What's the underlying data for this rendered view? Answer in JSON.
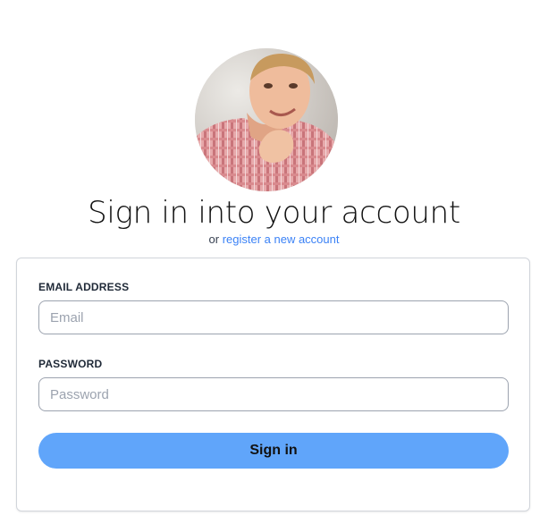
{
  "header": {
    "title": "Sign in into your account",
    "subtitle_prefix": "or",
    "register_link": "register a new account"
  },
  "form": {
    "email": {
      "label": "EMAIL ADDRESS",
      "placeholder": "Email",
      "value": ""
    },
    "password": {
      "label": "PASSWORD",
      "placeholder": "Password",
      "value": ""
    },
    "submit_label": "Sign in"
  },
  "colors": {
    "accent": "#60a5fa",
    "link": "#3b82f6",
    "border": "#d1d5db"
  }
}
